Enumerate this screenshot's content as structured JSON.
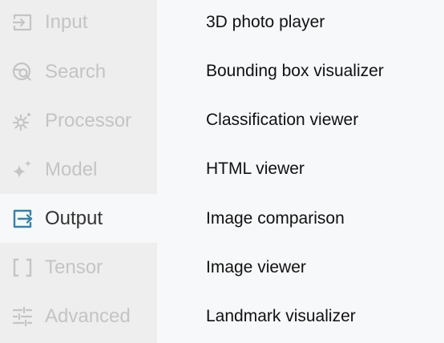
{
  "sidebar": {
    "items": [
      {
        "label": "Input",
        "icon": "input-icon"
      },
      {
        "label": "Search",
        "icon": "search-icon"
      },
      {
        "label": "Processor",
        "icon": "processor-gear-icon"
      },
      {
        "label": "Model",
        "icon": "model-sparkle-icon"
      },
      {
        "label": "Output",
        "icon": "output-icon",
        "active": true
      },
      {
        "label": "Tensor",
        "icon": "tensor-brackets-icon"
      },
      {
        "label": "Advanced",
        "icon": "advanced-sliders-icon"
      }
    ]
  },
  "main": {
    "items": [
      {
        "label": "3D photo player"
      },
      {
        "label": "Bounding box visualizer"
      },
      {
        "label": "Classification viewer"
      },
      {
        "label": "HTML viewer"
      },
      {
        "label": "Image comparison"
      },
      {
        "label": "Image viewer"
      },
      {
        "label": "Landmark visualizer"
      }
    ]
  },
  "colors": {
    "sidebar_bg": "#eeeeee",
    "active_bg": "#f7f8fa",
    "inactive_text": "#c4c4c4",
    "active_icon": "#3a7fa8"
  }
}
